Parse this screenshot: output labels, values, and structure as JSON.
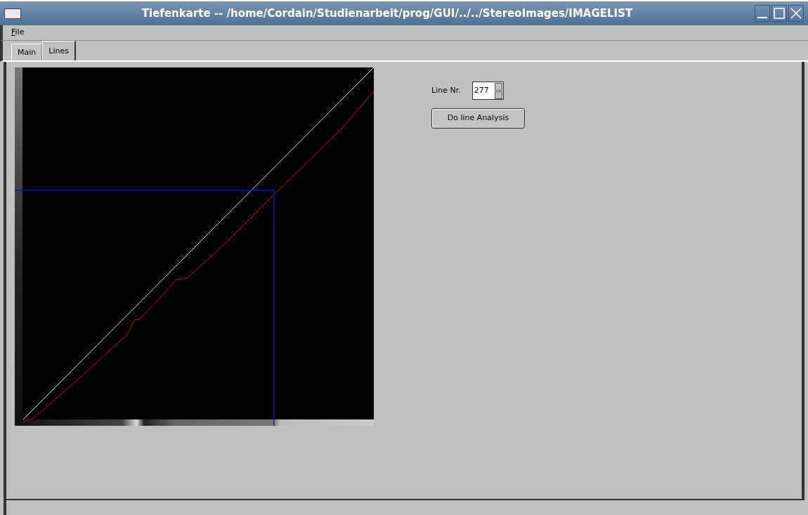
{
  "window": {
    "title": "Tiefenkarte -- /home/Cordain/Studienarbeit/prog/GUI/../../StereoImages/IMAGELIST"
  },
  "menu": [
    "File"
  ],
  "tabs": [
    {
      "label": "Main",
      "selected": false
    },
    {
      "label": "Lines",
      "selected": true
    }
  ],
  "line_nr": {
    "label": "Line Nr.",
    "value": "277"
  },
  "buttons": [
    "Do line Analysis"
  ]
}
